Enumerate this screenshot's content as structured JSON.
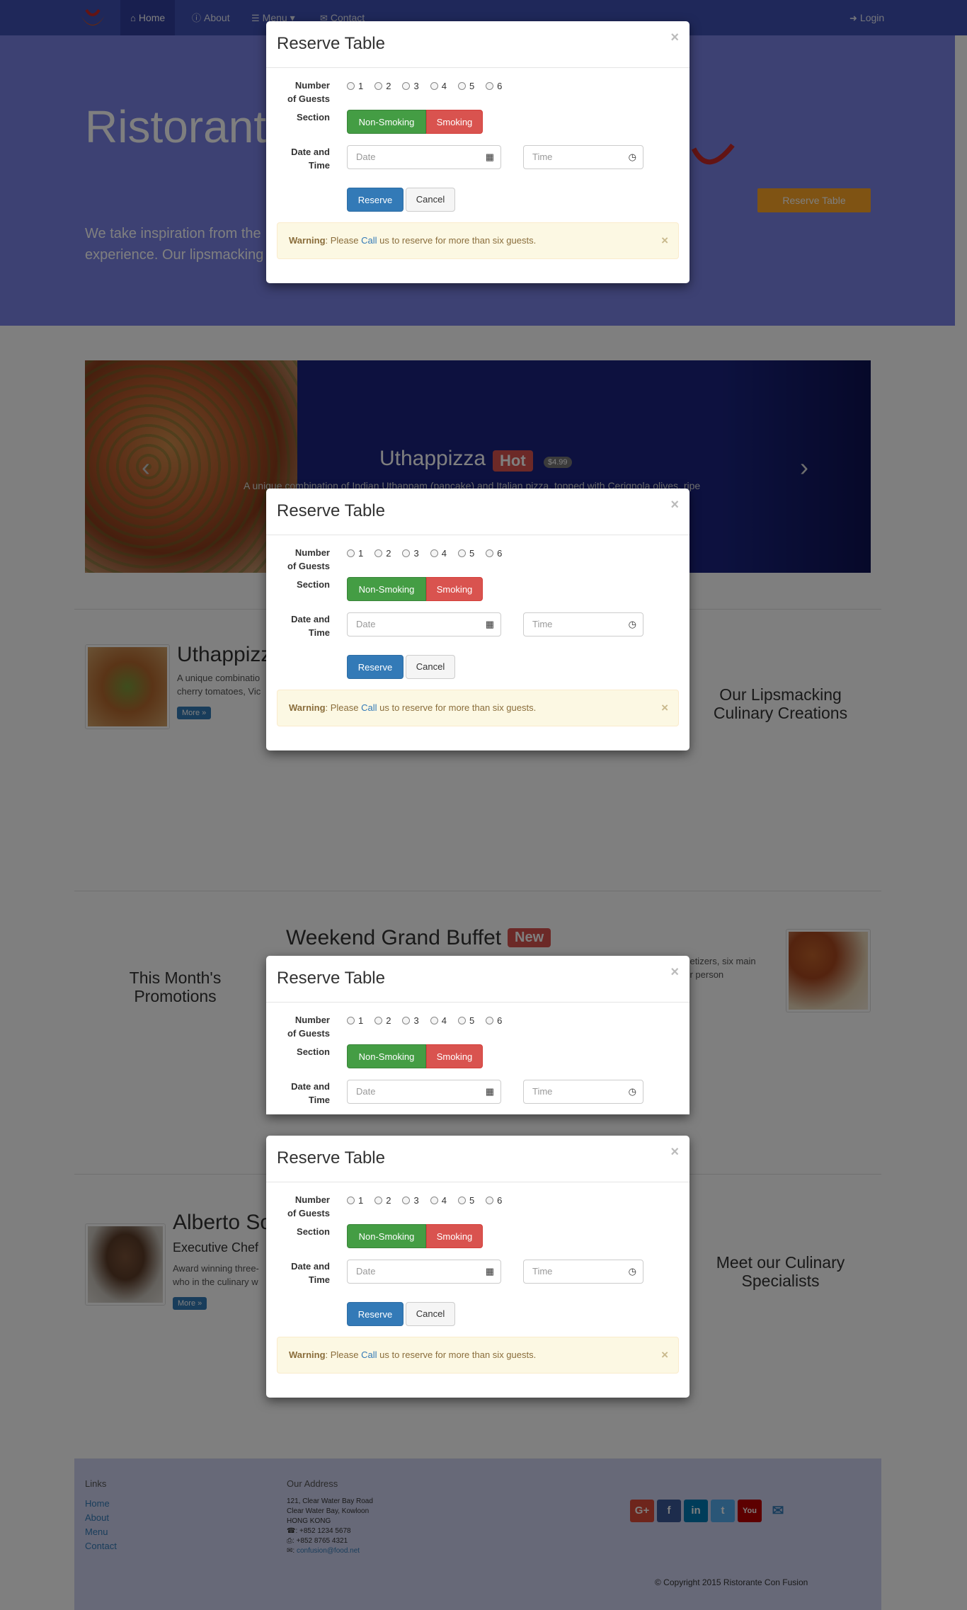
{
  "nav": {
    "items": [
      {
        "label": "Home",
        "icon": "home-icon"
      },
      {
        "label": "About",
        "icon": "info-icon"
      },
      {
        "label": "Menu",
        "icon": "list-icon"
      },
      {
        "label": "Contact",
        "icon": "envelope-icon"
      }
    ],
    "login": "Login"
  },
  "jumbotron": {
    "title": "Ristorante",
    "text_line1": "We take inspiration from the",
    "text_line2": "experience. Our lipsmacking",
    "reserve_button": "Reserve Table"
  },
  "carousel": {
    "title": "Uthappizza",
    "badge": "Hot",
    "price": "$4.99",
    "caption": "A unique combination of Indian Uthappam (pancake) and Italian pizza, topped with Cerignola olives, ripe"
  },
  "dish": {
    "title": "Uthappizz",
    "line1": "A unique combinatio",
    "line2": "cherry tomatoes, Vic",
    "more": "More »",
    "side_heading_1": "Our Lipsmacking",
    "side_heading_2": "Culinary Creations"
  },
  "promotion": {
    "title": "Weekend Grand Buffet",
    "badge": "New",
    "line1": "ppetizers, six main",
    "line2": "per person",
    "side_heading_1": "This Month's",
    "side_heading_2": "Promotions"
  },
  "chef": {
    "name": "Alberto Sc",
    "role": "Executive Chef",
    "line1": "Award winning three-",
    "line2": "who in the culinary w",
    "more": "More »",
    "side_heading_1": "Meet our Culinary",
    "side_heading_2": "Specialists"
  },
  "footer": {
    "links_heading": "Links",
    "links": [
      "Home",
      "About",
      "Menu",
      "Contact"
    ],
    "address_heading": "Our Address",
    "address": [
      "121, Clear Water Bay Road",
      "Clear Water Bay, Kowloon",
      "HONG KONG"
    ],
    "phone": "+852 1234 5678",
    "fax": "+852 8765 4321",
    "email": "confusion@food.net",
    "social": [
      {
        "label": "G+",
        "icon": "google-plus-icon",
        "color": "#dd4b39"
      },
      {
        "label": "f",
        "icon": "facebook-icon",
        "color": "#3b5998"
      },
      {
        "label": "in",
        "icon": "linkedin-icon",
        "color": "#007bb5"
      },
      {
        "label": "t",
        "icon": "twitter-icon",
        "color": "#55acee"
      },
      {
        "label": "You",
        "icon": "youtube-icon",
        "color": "#bb0000"
      }
    ],
    "copyright": "© Copyright 2015 Ristorante Con Fusion"
  },
  "modal": {
    "title": "Reserve Table",
    "close": "×",
    "guests_label_1": "Number",
    "guests_label_2": "of Guests",
    "guest_options": [
      "1",
      "2",
      "3",
      "4",
      "5",
      "6"
    ],
    "section_label": "Section",
    "non_smoking": "Non-Smoking",
    "smoking": "Smoking",
    "datetime_label_1": "Date and",
    "datetime_label_2": "Time",
    "date_placeholder": "Date",
    "time_placeholder": "Time",
    "reserve": "Reserve",
    "cancel": "Cancel",
    "warning_bold": "Warning",
    "warning_pre": ": Please ",
    "warning_link": "Call",
    "warning_post": " us to reserve for more than six guests.",
    "warning_close": "×"
  },
  "colors": {
    "navbar": "#3f51b5",
    "jumbotron": "#7b83e6",
    "reserve_button": "#ffa726",
    "carousel_bg": "#1a237e",
    "success": "#449d44",
    "danger": "#d9534f",
    "primary": "#337ab7",
    "warning_bg": "#fcf8e3"
  }
}
